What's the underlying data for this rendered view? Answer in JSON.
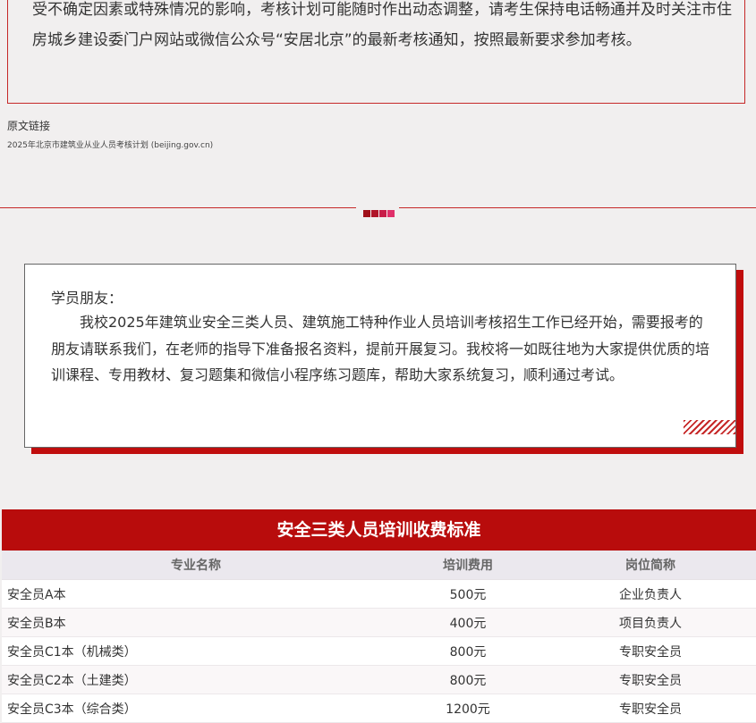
{
  "notice": {
    "text": "受不确定因素或特殊情况的影响，考核计划可能随时作出动态调整，请考生保持电话畅通并及时关注市住房城乡建设委门户网站或微信公众号“安居北京”的最新考核通知，按照最新要求参加考核。"
  },
  "source": {
    "label": "原文链接",
    "link_text": "2025年北京市建筑业从业人员考核计划 (beijing.gov.cn)"
  },
  "colors": {
    "accent": "#c62828",
    "divider_squares": [
      "#a0101a",
      "#b01428",
      "#c81c48",
      "#e0306a"
    ]
  },
  "letter": {
    "greeting": "学员朋友：",
    "body": "我校2025年建筑业安全三类人员、建筑施工特种作业人员培训考核招生工作已经开始，需要报考的朋友请联系我们，在老师的指导下准备报名资料，提前开展复习。我校将一如既往地为大家提供优质的培训课程、专用教材、复习题集和微信小程序练习题库，帮助大家系统复习，顺利通过考试。"
  },
  "fee_table": {
    "title": "安全三类人员培训收费标准",
    "headers": [
      "专业名称",
      "培训费用",
      "岗位简称"
    ],
    "rows": [
      [
        "安全员A本",
        "500元",
        "企业负责人"
      ],
      [
        "安全员B本",
        "400元",
        "项目负责人"
      ],
      [
        "安全员C1本（机械类）",
        "800元",
        "专职安全员"
      ],
      [
        "安全员C2本（土建类）",
        "800元",
        "专职安全员"
      ],
      [
        "安全员C3本（综合类）",
        "1200元",
        "专职安全员"
      ]
    ]
  }
}
